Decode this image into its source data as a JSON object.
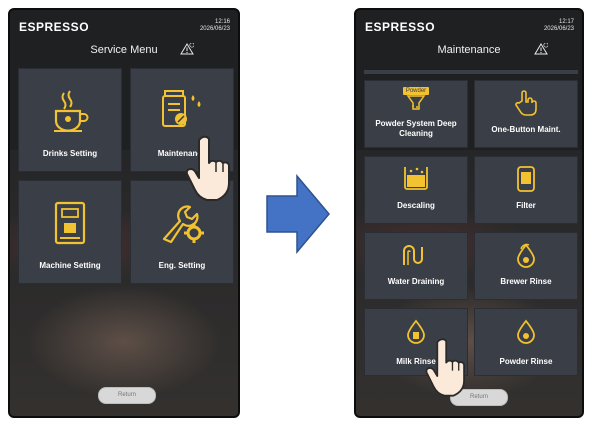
{
  "left_screen": {
    "brand": "ESPRESSO",
    "time": "12:16",
    "date": "2026/06/23",
    "title": "Service Menu",
    "tiles": [
      {
        "label": "Drinks Setting",
        "icon": "coffee-cup-icon"
      },
      {
        "label": "Maintenance",
        "icon": "maintenance-canister-icon"
      },
      {
        "label": "Machine Setting",
        "icon": "machine-icon"
      },
      {
        "label": "Eng. Setting",
        "icon": "wrench-gear-icon"
      }
    ],
    "return_label": "Return"
  },
  "right_screen": {
    "brand": "ESPRESSO",
    "time": "12:17",
    "date": "2026/06/23",
    "title": "Maintenance",
    "tiles": [
      {
        "label": "Powder System Deep Cleaning",
        "icon": "powder-icon",
        "icon_text": "Powder"
      },
      {
        "label": "One-Button Maint.",
        "icon": "touch-finger-icon"
      },
      {
        "label": "Descaling",
        "icon": "descaling-icon"
      },
      {
        "label": "Filter",
        "icon": "filter-icon"
      },
      {
        "label": "Water Draining",
        "icon": "water-drain-icon"
      },
      {
        "label": "Brewer Rinse",
        "icon": "brewer-rinse-icon"
      },
      {
        "label": "Milk Rinse",
        "icon": "milk-rinse-icon"
      },
      {
        "label": "Powder Rinse",
        "icon": "powder-rinse-icon"
      }
    ],
    "return_label": "Return"
  },
  "colors": {
    "accent_yellow": "#f2c230",
    "tile_bg": "#3a3e46",
    "arrow_blue": "#4472c4"
  }
}
